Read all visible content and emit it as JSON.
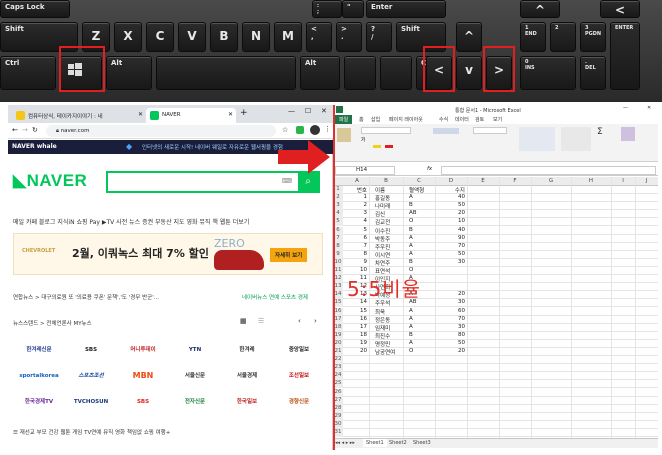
{
  "keyboard": {
    "keys": {
      "caps": "Caps Lock",
      "shift": "Shift",
      "z": "Z",
      "x": "X",
      "c": "C",
      "v": "V",
      "b": "B",
      "n": "N",
      "m": "M",
      "comma": "<\n,",
      "period": ">\n.",
      "slash": "?\n/",
      "rshift": "Shift",
      "enter": "Enter",
      "ctrl": "Ctrl",
      "alt": "Alt",
      "alt_r": "Alt",
      "ctrl_r": "Ctrl",
      "semicolon": ":\n;",
      "quote": "\"",
      "num1": "1\nEND",
      "num2": "2",
      "num3": "3\nPGDN",
      "num0": "0\nINS",
      "del": ".\nDEL",
      "numenter": "ENTER",
      "up": "^",
      "left": "<",
      "down": "v",
      "right": ">",
      "numup": "^",
      "numleft": "<"
    }
  },
  "chrome": {
    "tabs": [
      {
        "label": "컴퓨터상식, 테이카지이야기 : 네",
        "color": "#f5c518"
      },
      {
        "label": "NAVER",
        "color": "#03c75a"
      }
    ],
    "address": "naver.com",
    "banner_brand": "NAVER whale",
    "banner_text": "인터넷의 새로운 시작! 네이버 웨일로 자유로운 웹서핑을 경험",
    "logo": "NAVER",
    "menu": "메일  카페  블로그  지식iN  쇼핑  Pay  ▶TV  사전  뉴스  증권  부동산  지도  영화  뮤직  책  웹툰     더보기",
    "ad": {
      "brand": "CHEVROLET",
      "title": "2월, 이쿼녹스 최대 7% 할인",
      "car": "ZERO",
      "cta": "자세히 보기"
    },
    "news_line1": "연합뉴스 > 대구의료원 또 '의료용 쿠폰'  문책','도 '경무 반군'...",
    "news_line1_tabs": "네이버뉴스  연예  스포츠  경제",
    "news_line2": "뉴스스탠드 >  전체언론사   MY뉴스",
    "press": [
      [
        "한겨레신문",
        "SBS",
        "머니투데이",
        "YTN",
        "한겨레",
        "중앙일보"
      ],
      [
        "sportalkorea",
        "스포츠조선",
        "MBN",
        "서울신문",
        "서울경제",
        "조선일보"
      ],
      [
        "한국경제TV",
        "TVCHOSUN",
        "SBS",
        "전자신문",
        "한국일보",
        "경향신문"
      ]
    ],
    "bottomnav": "재선교  부모  건강  웹툰  게임  TV연예  뮤직  영화  책임없  쇼핑  여행+"
  },
  "excel": {
    "title": "통합 문서1 - Microsoft Excel",
    "ribbon_tabs": [
      "파일",
      "홈",
      "삽입",
      "페이지 레이아웃",
      "수식",
      "데이터",
      "검토",
      "보기"
    ],
    "namebox": "H14",
    "fx": "fx",
    "columns": [
      "A",
      "B",
      "C",
      "D",
      "E",
      "F",
      "G",
      "H",
      "I",
      "J"
    ],
    "header_row": [
      "번호",
      "이름",
      "혈액형",
      "수지"
    ],
    "rows": [
      [
        "1",
        "홍길동",
        "A",
        "40"
      ],
      [
        "2",
        "나미래",
        "B",
        "50"
      ],
      [
        "3",
        "김신",
        "AB",
        "20"
      ],
      [
        "4",
        "김교전",
        "O",
        "10"
      ],
      [
        "5",
        "이수진",
        "B",
        "40"
      ],
      [
        "6",
        "박동주",
        "A",
        "90"
      ],
      [
        "7",
        "주우진",
        "A",
        "70"
      ],
      [
        "8",
        "이시연",
        "A",
        "50"
      ],
      [
        "9",
        "차연주",
        "B",
        "30"
      ],
      [
        "10",
        "표연석",
        "O",
        ""
      ],
      [
        "11",
        "이인지",
        "A",
        ""
      ],
      [
        "12",
        "사연희",
        "",
        ""
      ],
      [
        "13",
        "박예정",
        "A",
        "20"
      ],
      [
        "14",
        "주우석",
        "AB",
        "30"
      ],
      [
        "15",
        "최욱",
        "A",
        "60"
      ],
      [
        "16",
        "정은동",
        "A",
        "70"
      ],
      [
        "17",
        "임재미",
        "A",
        "30"
      ],
      [
        "18",
        "최진수",
        "B",
        "80"
      ],
      [
        "19",
        "명정민",
        "A",
        "50"
      ],
      [
        "20",
        "남궁연여",
        "O",
        "20"
      ]
    ],
    "sheets": [
      "Sheet1",
      "Sheet2",
      "Sheet3"
    ]
  },
  "overlay": "5:5비율"
}
